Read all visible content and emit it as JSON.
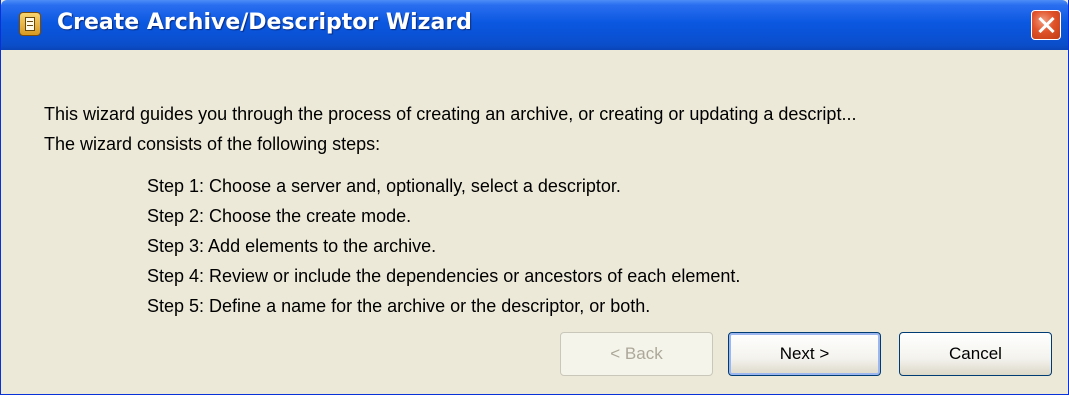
{
  "window": {
    "title": "Create Archive/Descriptor Wizard",
    "app_icon": "archive-wizard-icon",
    "close_icon": "close-icon"
  },
  "content": {
    "intro_line1": "This wizard guides you through the process of creating an archive, or creating or updating a descript...",
    "intro_line2": "The wizard consists of the following steps:",
    "steps": [
      "Step 1: Choose a server and, optionally, select a descriptor.",
      "Step 2: Choose the create mode.",
      "Step 3: Add elements to the archive.",
      "Step 4: Review or include the dependencies or ancestors of each element.",
      "Step 5: Define a name for the archive or the descriptor, or both."
    ]
  },
  "buttons": {
    "back_label": "< Back",
    "back_enabled": false,
    "next_label": "Next >",
    "cancel_label": "Cancel"
  },
  "colors": {
    "titlebar": "#0a52d6",
    "dialog_background": "#ece9d8",
    "close_button": "#e0522a"
  }
}
